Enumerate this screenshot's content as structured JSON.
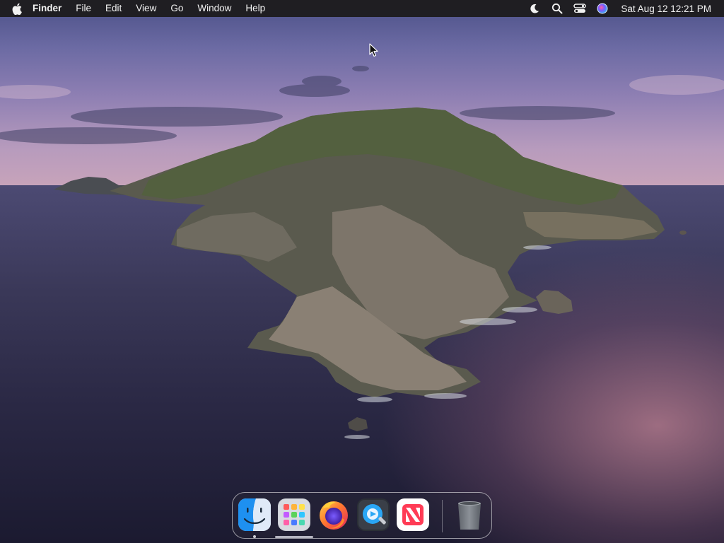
{
  "menubar": {
    "apple_icon": "apple-icon",
    "app_name": "Finder",
    "menus": [
      "File",
      "Edit",
      "View",
      "Go",
      "Window",
      "Help"
    ],
    "status_icons": [
      "moon-icon",
      "search-icon",
      "control-center-icon",
      "siri-icon"
    ],
    "clock": "Sat Aug 12  12:21 PM"
  },
  "dock": {
    "apps": [
      {
        "name": "Finder",
        "icon": "finder-icon",
        "running": true
      },
      {
        "name": "Launchpad",
        "icon": "launchpad-icon",
        "running": false
      },
      {
        "name": "Firefox",
        "icon": "firefox-icon",
        "running": false
      },
      {
        "name": "QuickTime Player",
        "icon": "quicktime-icon",
        "running": false
      },
      {
        "name": "News",
        "icon": "news-icon",
        "running": false
      }
    ],
    "trash": {
      "name": "Trash",
      "icon": "trash-icon"
    }
  }
}
